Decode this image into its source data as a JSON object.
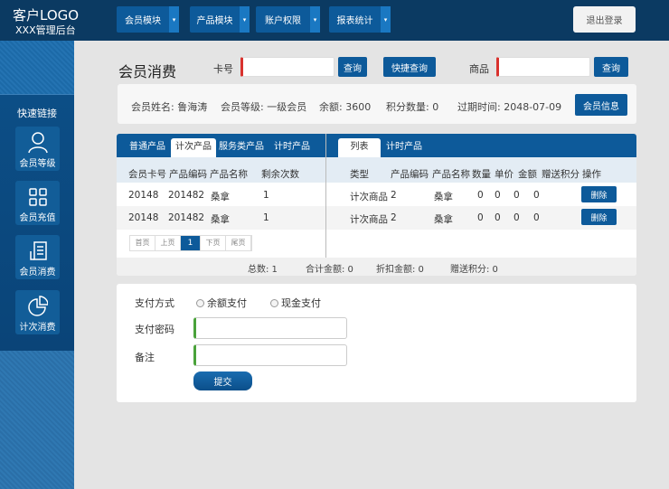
{
  "header": {
    "logo": "客户LOGO",
    "subtitle": "XXX管理后台",
    "nav": [
      {
        "label": "会员模块"
      },
      {
        "label": "产品模块"
      },
      {
        "label": "账户权限"
      },
      {
        "label": "报表统计"
      }
    ],
    "dropdown_arrow": "▾",
    "logout": "退出登录"
  },
  "sidebar": {
    "title": "快速链接",
    "items": [
      {
        "label": "会员等级",
        "icon": "user-icon"
      },
      {
        "label": "会员充值",
        "icon": "grid-icon"
      },
      {
        "label": "会员消费",
        "icon": "receipt-icon"
      },
      {
        "label": "计次消费",
        "icon": "pie-chart-icon"
      }
    ]
  },
  "search": {
    "title": "会员消费",
    "card_label": "卡号",
    "card_value": "",
    "query": "查询",
    "quick_query": "快捷查询",
    "product_label": "商品",
    "product_value": "",
    "query2": "查询"
  },
  "member": {
    "name": "会员姓名: 鲁海涛",
    "level": "会员等级: 一级会员",
    "balance": "余额: 3600",
    "points": "积分数量: 0",
    "expiry": "过期时间: 2048-07-09",
    "info_button": "会员信息"
  },
  "left_table": {
    "tabs": [
      "普通产品",
      "计次产品",
      "服务类产品",
      "计时产品"
    ],
    "active_tab": 1,
    "columns": [
      "会员卡号",
      "产品编码",
      "产品名称",
      "剩余次数"
    ],
    "rows": [
      [
        "20148",
        "201482",
        "桑拿",
        "1"
      ],
      [
        "20148",
        "201482",
        "桑拿",
        "1"
      ]
    ],
    "pager": [
      "首页",
      "上页",
      "1",
      "下页",
      "尾页"
    ]
  },
  "right_table": {
    "tabs": [
      "列表",
      "计时产品"
    ],
    "active_tab": 0,
    "columns": [
      "类型",
      "产品编码",
      "产品名称",
      "数量",
      "单价",
      "金额",
      "赠送积分",
      "操作"
    ],
    "rows": [
      [
        "计次商品",
        "2",
        "桑拿",
        "0",
        "0",
        "0",
        "0"
      ],
      [
        "计次商品",
        "2",
        "桑拿",
        "0",
        "0",
        "0",
        "0"
      ]
    ],
    "delete": "删除"
  },
  "totals": {
    "count": "总数: 1",
    "sum": "合计金额: 0",
    "discount": "折扣金额: 0",
    "bonus": "赠送积分: 0"
  },
  "form": {
    "pay_method_label": "支付方式",
    "options": [
      "余额支付",
      "现金支付"
    ],
    "password_label": "支付密码",
    "password_value": "",
    "note_label": "备注",
    "note_value": "",
    "submit": "提交"
  },
  "colors": {
    "header": "#0b3a62",
    "primary": "#0d5a9a",
    "required_red": "#d9322e",
    "valid_green": "#4aa23a"
  }
}
